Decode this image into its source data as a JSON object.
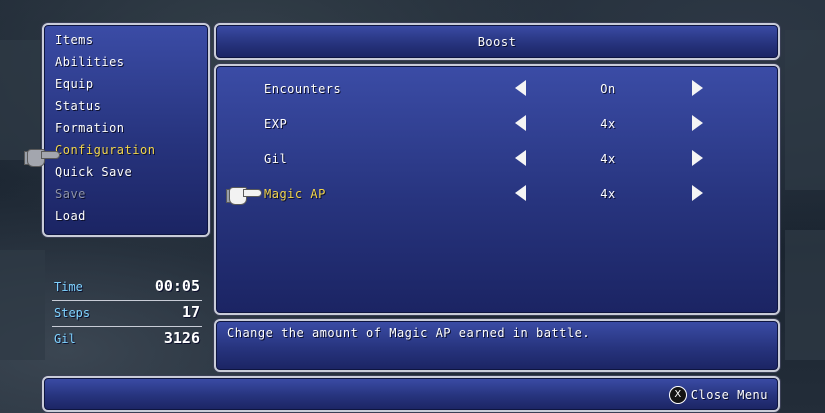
{
  "menu": {
    "items": [
      {
        "label": "Items",
        "state": "normal"
      },
      {
        "label": "Abilities",
        "state": "normal"
      },
      {
        "label": "Equip",
        "state": "normal"
      },
      {
        "label": "Status",
        "state": "normal"
      },
      {
        "label": "Formation",
        "state": "normal"
      },
      {
        "label": "Configuration",
        "state": "active"
      },
      {
        "label": "Quick Save",
        "state": "normal"
      },
      {
        "label": "Save",
        "state": "disabled"
      },
      {
        "label": "Load",
        "state": "normal"
      }
    ]
  },
  "stats": {
    "time_label": "Time",
    "time_value": "00:05",
    "steps_label": "Steps",
    "steps_value": "17",
    "gil_label": "Gil",
    "gil_value": "3126"
  },
  "panel": {
    "title": "Boost"
  },
  "options": [
    {
      "label": "Encounters",
      "value": "On"
    },
    {
      "label": "EXP",
      "value": "4x"
    },
    {
      "label": "Gil",
      "value": "4x"
    },
    {
      "label": "Magic AP",
      "value": "4x"
    }
  ],
  "description": "Change the amount of Magic AP earned in battle.",
  "footer": {
    "button_glyph": "X",
    "close_label": "Close Menu"
  },
  "colors": {
    "window_top": "#3b4ca6",
    "window_bottom": "#1b2463",
    "highlight": "#f2d64b",
    "stat_label": "#7fd3ff",
    "disabled": "#8d93a8"
  },
  "icons": {
    "cursor": "pointing-glove-icon",
    "left_arrow": "left-arrow-icon",
    "right_arrow": "right-arrow-icon",
    "close_button": "x-button-icon"
  }
}
